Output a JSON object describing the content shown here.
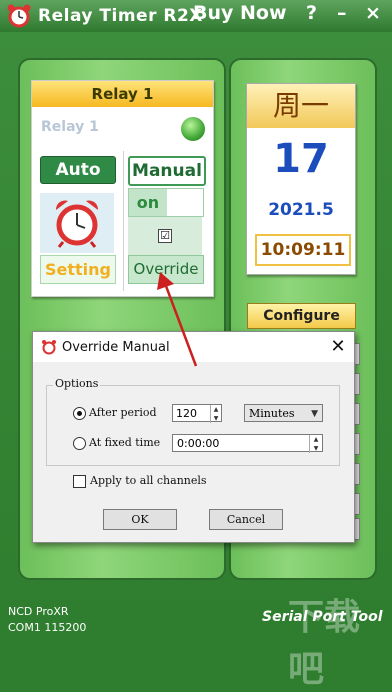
{
  "window": {
    "title": "Relay Timer R2X",
    "buy_now": "Buy Now",
    "help": "?",
    "minimize": "–",
    "close": "×"
  },
  "relay": {
    "header": "Relay 1",
    "name": "Relay 1",
    "auto_label": "Auto",
    "manual_label": "Manual",
    "on_label": "on",
    "override_checked": "☑",
    "setting_label": "Setting",
    "override_label": "Override",
    "led_color": "#42a838"
  },
  "date": {
    "weekday": "周一",
    "day": "17",
    "month_year": "2021.5",
    "time": "10:09:11"
  },
  "configure_label": "Configure",
  "dialog": {
    "title": "Override Manual",
    "close": "✕",
    "options_label": "Options",
    "after_period_label": "After period",
    "after_period_value": "120",
    "unit_value": "Minutes",
    "fixed_time_label": "At fixed time",
    "fixed_time_value": "0:00:00",
    "apply_all_label": "Apply to all channels",
    "ok_label": "OK",
    "cancel_label": "Cancel"
  },
  "status": {
    "device": "NCD ProXR",
    "port": "COM1 115200",
    "brand": "Serial Port Tool"
  },
  "watermark": "下载吧",
  "colors": {
    "accent_green": "#2e8a45",
    "gold": "#f5b820",
    "date_blue": "#1c4dbd",
    "arrow_red": "#cc2020"
  }
}
